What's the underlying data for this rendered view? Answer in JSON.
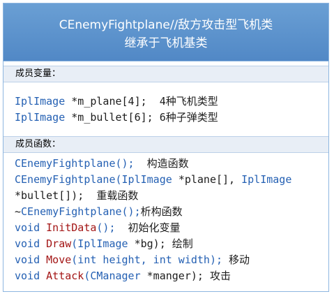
{
  "header": {
    "line1": "CEnemyFightplane//敌方攻击型飞机类",
    "line2": "继承于飞机基类"
  },
  "members": {
    "label": "成员变量：",
    "lines": [
      {
        "type": "IplImage",
        "rest": " *m_plane[4];",
        "comment": "  4种飞机类型"
      },
      {
        "type": "IplImage",
        "rest": " *m_bullet[6];",
        "comment": " 6种子弹类型"
      }
    ]
  },
  "functions": {
    "label": "成员函数：",
    "l1_sig": "CEnemyFightplane();",
    "l1_comment": "  构造函数",
    "l2_a": "CEnemyFightplane(IplImage ",
    "l2_b": "*plane[], ",
    "l2_c": "IplImage",
    "l3_a": "*bullet[]);",
    "l3_comment": "  重载函数",
    "l4_tilde": "~",
    "l4_sig": "CEnemyFightplane();",
    "l4_comment": "析构函数",
    "l5_kw": "void ",
    "l5_name": "InitData",
    "l5_args": "();",
    "l5_comment": "  初始化变量",
    "l6_kw": "void ",
    "l6_name": "Draw",
    "l6_args_a": "(IplImage ",
    "l6_args_b": "*bg);",
    "l6_comment": " 绘制",
    "l7_kw": "void ",
    "l7_name": "Move",
    "l7_args": "(int height, int width);",
    "l7_comment": " 移动",
    "l8_kw": "void ",
    "l8_name": "Attack",
    "l8_args_a": "(CManager ",
    "l8_args_b": "*manger);",
    "l8_comment": " 攻击"
  },
  "colors": {
    "header_bg": "#5a90cc",
    "type_blue": "#2460b3",
    "func_red": "#a31515",
    "section_bg": "#e8eef6"
  }
}
